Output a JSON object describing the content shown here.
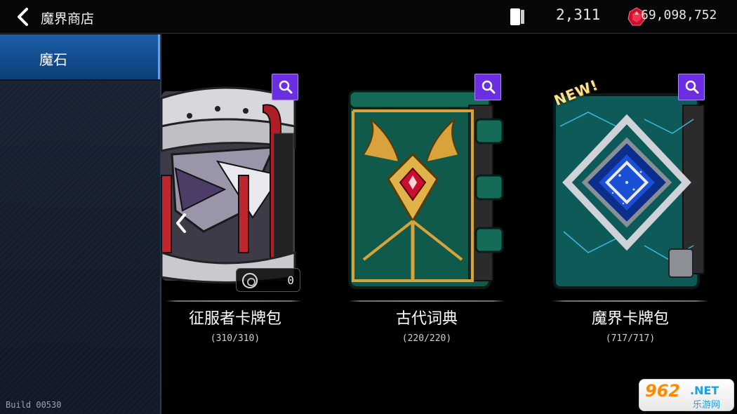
{
  "header": {
    "back_icon": "chevron-left-icon",
    "title": "魔界商店",
    "card_currency_icon": "card-icon",
    "card_currency_value": "2,311",
    "gem_currency_icon": "red-gem-icon",
    "gem_currency_value": "69,098,752"
  },
  "sidebar": {
    "tabs": [
      {
        "label": "魔石",
        "selected": true
      }
    ],
    "build": "Build 00530"
  },
  "products": [
    {
      "name": "征服者卡牌包",
      "count": "(310/310)",
      "owned": "0",
      "new": false
    },
    {
      "name": "古代词典",
      "count": "(220/220)",
      "new": false
    },
    {
      "name": "魔界卡牌包",
      "count": "(717/717)",
      "new": true,
      "new_label": "NEW!"
    }
  ],
  "watermark": {
    "number": "962",
    "suffix": ".NET",
    "site": "乐游网"
  },
  "colors": {
    "accent_purple": "#6b2ee0",
    "tab_blue": "#1b5ea8",
    "pack_green": "#0f5a4a"
  }
}
